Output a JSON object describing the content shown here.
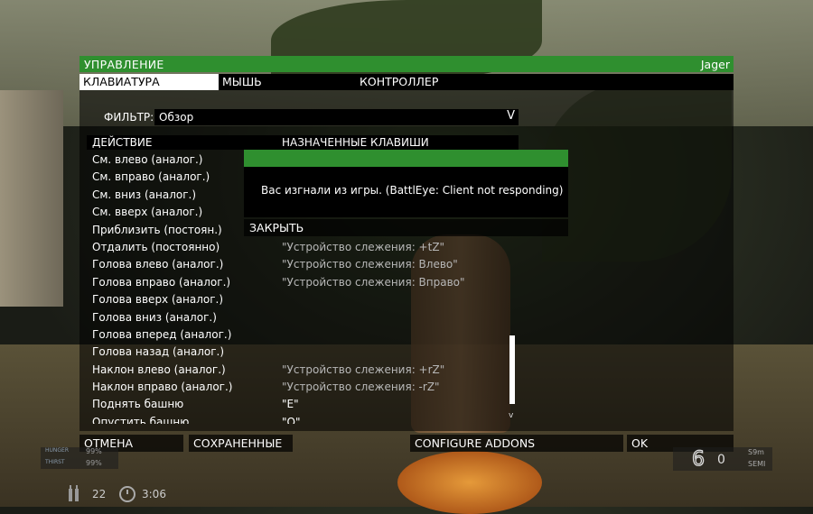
{
  "header": {
    "title": "УПРАВЛЕНИЕ",
    "user": "Jager"
  },
  "tabs": [
    {
      "label": "КЛАВИАТУРА",
      "active": true
    },
    {
      "label": "МЫШЬ",
      "active": false
    },
    {
      "label": "КОНТРОЛЛЕР",
      "active": false
    }
  ],
  "filter": {
    "label": "ФИЛЬТР:",
    "value": "Обзор"
  },
  "columns": {
    "action": "ДЕЙСТВИЕ",
    "keys": "НАЗНАЧЕННЫЕ КЛАВИШИ"
  },
  "rows": [
    {
      "action": "См. влево (аналог.)",
      "keys": ""
    },
    {
      "action": "См. вправо (аналог.)",
      "keys": ""
    },
    {
      "action": "См. вниз (аналог.)",
      "keys": ""
    },
    {
      "action": "См. вверх (аналог.)",
      "keys": ""
    },
    {
      "action": "Приблизить (постоян.)",
      "keys": ""
    },
    {
      "action": "Отдалить (постоянно)",
      "keys": "\"Устройство слежения: +tZ\""
    },
    {
      "action": "Голова влево (аналог.)",
      "keys": "\"Устройство слежения: Влево\""
    },
    {
      "action": "Голова вправо (аналог.)",
      "keys": "\"Устройство слежения: Вправо\""
    },
    {
      "action": "Голова вверх (аналог.)",
      "keys": ""
    },
    {
      "action": "Голова вниз (аналог.)",
      "keys": ""
    },
    {
      "action": "Голова вперед (аналог.)",
      "keys": ""
    },
    {
      "action": "Голова назад (аналог.)",
      "keys": ""
    },
    {
      "action": "Наклон влево (аналог.)",
      "keys": "\"Устройство слежения: +rZ\""
    },
    {
      "action": "Наклон вправо (аналог.)",
      "keys": "\"Устройство слежения: -rZ\""
    },
    {
      "action": "Поднять башню",
      "keys": "\"E\""
    },
    {
      "action": "Опустить башню",
      "keys": "\"Q\""
    }
  ],
  "dialog": {
    "message": "Вас изгнали из игры. (BattlEye: Client not responding)",
    "button": "ЗАКРЫТЬ"
  },
  "buttons": {
    "cancel": "ОТМЕНА",
    "saved": "СОХРАНЕННЫЕ",
    "addons": "CONFIGURE ADDONS",
    "ok": "OK"
  },
  "hud": {
    "hunger_label": "HUNGER",
    "hunger_value": "99%",
    "thirst_label": "THIRST",
    "thirst_value": "99%",
    "count": "22",
    "time": "3:06",
    "ammo": "6",
    "ammo_sub": "0",
    "fire_1": "S9m",
    "fire_2": "SEMI"
  }
}
